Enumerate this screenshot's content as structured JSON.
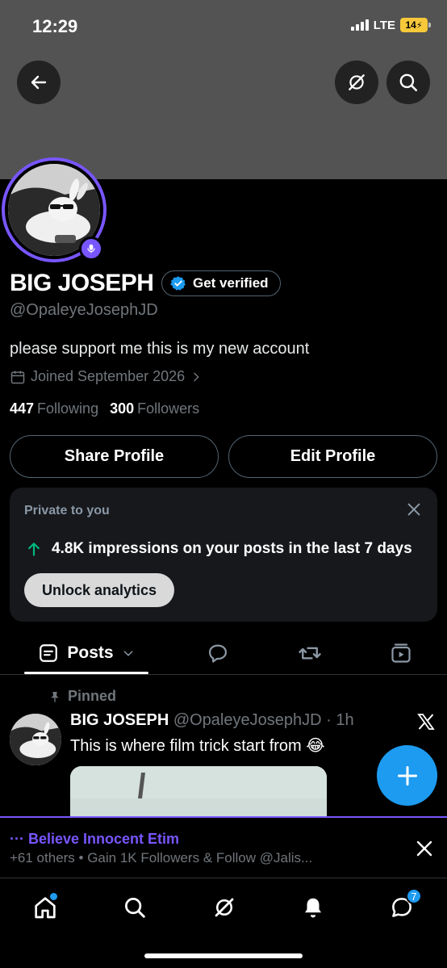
{
  "status_bar": {
    "time": "12:29",
    "network": "LTE",
    "battery": "14"
  },
  "profile": {
    "name": "BIG JOSEPH",
    "verify_label": "Get verified",
    "handle": "@OpaleyeJosephJD",
    "bio": "please support me this is my new account",
    "joined": "Joined September 2026",
    "following_count": "447",
    "following_label": "Following",
    "followers_count": "300",
    "followers_label": "Followers"
  },
  "buttons": {
    "share": "Share Profile",
    "edit": "Edit Profile"
  },
  "analytics_card": {
    "title": "Private to you",
    "impressions_text": "4.8K impressions on your posts in the last 7 days",
    "unlock_label": "Unlock analytics"
  },
  "tabs": {
    "posts_label": "Posts"
  },
  "pinned_post": {
    "pinned_label": "Pinned",
    "author": "BIG JOSEPH",
    "meta": "@OpaleyeJosephJD · 1h",
    "text": "This is where film trick start from 😂"
  },
  "promo": {
    "title": "··· Believe Innocent Etim",
    "subtitle": "+61 others • Gain 1K Followers & Follow @Jalis..."
  },
  "nav": {
    "messages_badge": "7"
  },
  "colors": {
    "accent_purple": "#7856ff",
    "brand_blue": "#1d9bf0",
    "banner_gray": "#535353"
  },
  "icons": [
    "back-arrow-icon",
    "grok-icon",
    "search-icon",
    "verified-check-icon",
    "calendar-icon",
    "chevron-right-icon",
    "arrow-up-icon",
    "close-icon",
    "posts-icon",
    "chevron-down-icon",
    "replies-icon",
    "retweet-icon",
    "media-icon",
    "pin-icon",
    "x-logo-icon",
    "plus-icon",
    "home-icon",
    "bell-icon",
    "messages-icon",
    "microphone-icon"
  ]
}
